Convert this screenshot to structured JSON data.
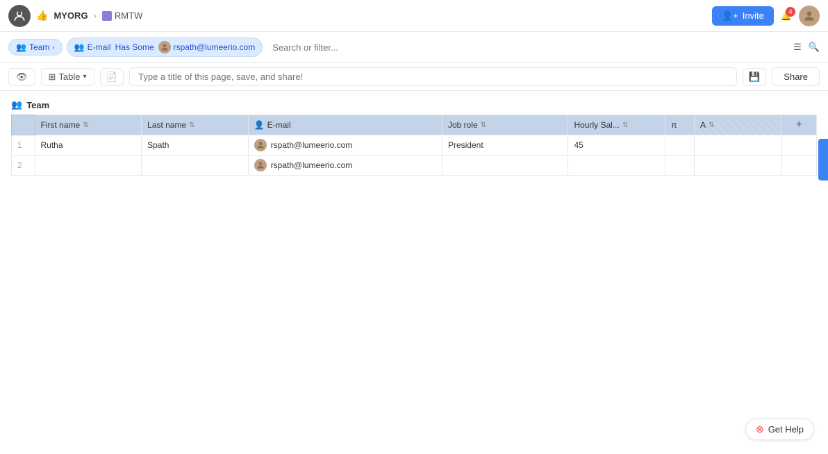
{
  "topnav": {
    "org": "MYORG",
    "page": "RMTW",
    "invite_label": "Invite",
    "notification_count": "4"
  },
  "filter_bar": {
    "team_label": "Team",
    "email_label": "E-mail",
    "has_some_label": "Has Some",
    "email_value": "rspath@lumeerio.com",
    "search_placeholder": "Search or filter..."
  },
  "toolbar": {
    "view_label": "Table",
    "title_placeholder": "Type a title of this page, save, and share!",
    "share_label": "Share"
  },
  "table": {
    "group_name": "Team",
    "columns": [
      {
        "key": "first_name",
        "label": "First name",
        "sortable": true
      },
      {
        "key": "last_name",
        "label": "Last name",
        "sortable": true
      },
      {
        "key": "email",
        "label": "E-mail",
        "sortable": false
      },
      {
        "key": "job_role",
        "label": "Job role",
        "sortable": true
      },
      {
        "key": "hourly_sal",
        "label": "Hourly Sal...",
        "sortable": true
      },
      {
        "key": "pi",
        "label": "π",
        "sortable": false
      },
      {
        "key": "a",
        "label": "A",
        "sortable": false
      }
    ],
    "rows": [
      {
        "num": "1",
        "first_name": "Rutha",
        "last_name": "Spath",
        "email": "rspath@lumeerio.com",
        "has_avatar": true,
        "job_role": "President",
        "hourly_sal": "45",
        "pi": "",
        "a": ""
      },
      {
        "num": "2",
        "first_name": "",
        "last_name": "",
        "email": "rspath@lumeerio.com",
        "has_avatar": true,
        "job_role": "",
        "hourly_sal": "",
        "pi": "",
        "a": ""
      }
    ]
  },
  "get_help_label": "Get Help"
}
